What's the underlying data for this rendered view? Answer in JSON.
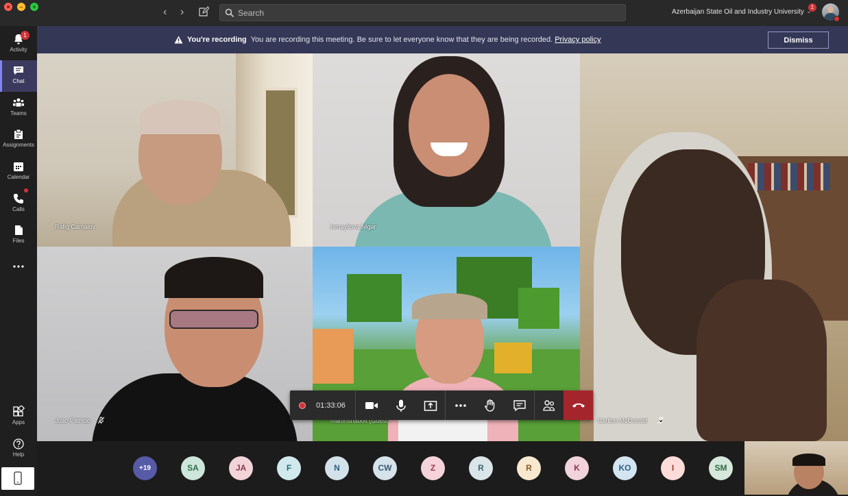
{
  "header": {
    "search_placeholder": "Search",
    "org_name": "Azerbaijan State Oil and Industry University",
    "org_badge": "1"
  },
  "sidebar": {
    "items": [
      {
        "label": "Activity",
        "icon": "bell-icon",
        "badge": "1"
      },
      {
        "label": "Chat",
        "icon": "chat-icon"
      },
      {
        "label": "Teams",
        "icon": "teams-icon"
      },
      {
        "label": "Assignments",
        "icon": "assignments-icon"
      },
      {
        "label": "Calendar",
        "icon": "calendar-icon"
      },
      {
        "label": "Calls",
        "icon": "phone-icon"
      },
      {
        "label": "Files",
        "icon": "file-icon"
      }
    ],
    "bottom_items": [
      {
        "label": "Apps",
        "icon": "apps-icon"
      },
      {
        "label": "Help",
        "icon": "help-icon"
      }
    ]
  },
  "banner": {
    "title": "You're recording",
    "message": "You are recording this meeting. Be sure to let everyone know that they are being recorded.",
    "link": "Privacy policy",
    "dismiss": "Dismiss"
  },
  "participants": [
    {
      "name": "Rafig Camalov"
    },
    {
      "name": "Ismayilova Nigar"
    },
    {
      "name": "Carlton McDonald"
    },
    {
      "name": "Joao Patricio"
    },
    {
      "name": "martinsnabolt (Guest)"
    }
  ],
  "toolbar": {
    "timer": "01:33:06"
  },
  "roster": {
    "more": "+19",
    "avatars": [
      {
        "initials": "SA",
        "bg": "#cde5da",
        "fg": "#27704a"
      },
      {
        "initials": "JA",
        "bg": "#f1d3d8",
        "fg": "#8a3a4a"
      },
      {
        "initials": "F",
        "bg": "#d1e9ec",
        "fg": "#1f6e7a"
      },
      {
        "initials": "N",
        "bg": "#d3e2ea",
        "fg": "#2a5f80"
      },
      {
        "initials": "CW",
        "bg": "#d6e2ea",
        "fg": "#365a74"
      },
      {
        "initials": "Z",
        "bg": "#f4d3da",
        "fg": "#9b3650"
      },
      {
        "initials": "R",
        "bg": "#d9e5e8",
        "fg": "#3f6470"
      },
      {
        "initials": "R",
        "bg": "#f8e8cf",
        "fg": "#8a5a1f"
      },
      {
        "initials": "K",
        "bg": "#f1d3dc",
        "fg": "#8e3454"
      },
      {
        "initials": "KO",
        "bg": "#d3e5f0",
        "fg": "#2b5f84"
      },
      {
        "initials": "I",
        "bg": "#fbdcd8",
        "fg": "#a3392c"
      },
      {
        "initials": "SM",
        "bg": "#d6e8dc",
        "fg": "#2e6a44"
      }
    ]
  },
  "colors": {
    "banner": "#343755",
    "hangup": "#a4262c",
    "accent": "#7f85f5"
  }
}
